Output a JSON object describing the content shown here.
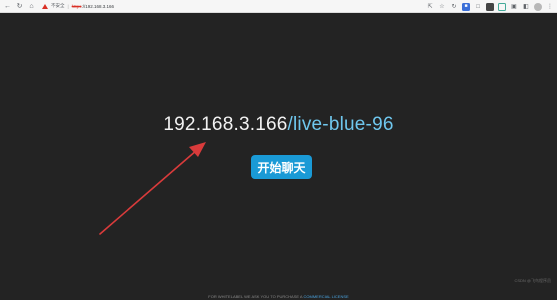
{
  "browser": {
    "address": {
      "security_text": "不安全",
      "scheme": "https",
      "rest": "://192.168.3.166"
    },
    "icons": [
      "back-icon",
      "forward-icon",
      "reload-icon",
      "home-icon",
      "warning-icon",
      "share-icon",
      "bookmark-icon",
      "extension-icon",
      "puzzle-icon",
      "profile-avatar",
      "menu-icon"
    ]
  },
  "main": {
    "room_ip": "192.168.3.166",
    "room_path": "/live-blue-96",
    "start_button": "开始聊天",
    "footer": {
      "text": "FOR WHITELABEL WE ASK YOU TO PURCHASE A ",
      "link": "COMMERCIAL LICENSE"
    },
    "watermark": "CSDN @飞鸟程序员"
  },
  "colors": {
    "background": "#232323",
    "button": "#1a9ad6",
    "path": "#6fc7ee",
    "arrow": "#d93b3b"
  }
}
